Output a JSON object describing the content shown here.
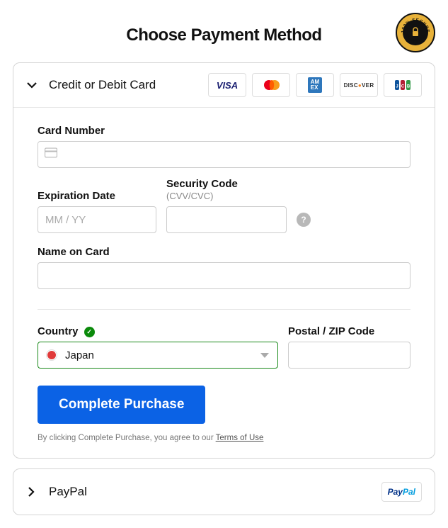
{
  "header": {
    "title": "Choose Payment Method",
    "secure_badge": "100% SECURE SHOPPING"
  },
  "card_section": {
    "title": "Credit or Debit Card",
    "logos": [
      "VISA",
      "Mastercard",
      "American Express",
      "Discover",
      "JCB"
    ],
    "card_number": {
      "label": "Card Number",
      "value": ""
    },
    "expiration": {
      "label": "Expiration Date",
      "placeholder": "MM / YY",
      "value": ""
    },
    "security": {
      "label": "Security Code",
      "sublabel": "(CVV/CVC)",
      "value": ""
    },
    "name": {
      "label": "Name on Card",
      "value": ""
    },
    "country": {
      "label": "Country",
      "value": "Japan",
      "validated": true
    },
    "postal": {
      "label": "Postal / ZIP Code",
      "value": ""
    },
    "submit_label": "Complete Purchase",
    "terms_prefix": "By clicking Complete Purchase, you agree to our ",
    "terms_link": "Terms of Use"
  },
  "paypal_section": {
    "title": "PayPal",
    "logo_text": "PayPal"
  }
}
